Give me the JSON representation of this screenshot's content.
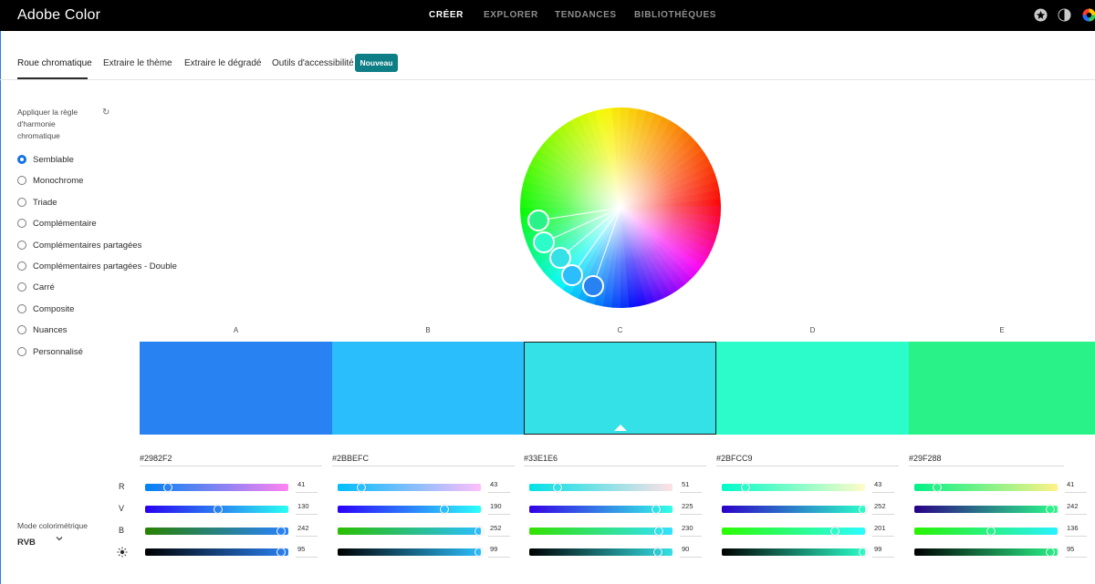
{
  "app": {
    "title": "Adobe Color"
  },
  "nav": {
    "items": [
      "CRÉER",
      "EXPLORER",
      "TENDANCES",
      "BIBLIOTHÈQUES"
    ],
    "active": "CRÉER"
  },
  "top_icons": [
    "star-circle-icon",
    "contrast-icon",
    "color-wheel-icon"
  ],
  "subtabs": {
    "items": [
      "Roue chromatique",
      "Extraire le thème",
      "Extraire le dégradé",
      "Outils d'accessibilité"
    ],
    "active": "Roue chromatique",
    "badge": "Nouveau"
  },
  "harmony": {
    "label": "Appliquer la règle d'harmonie chromatique",
    "selected": "Semblable",
    "options": [
      "Semblable",
      "Monochrome",
      "Triade",
      "Complémentaire",
      "Complémentaires partagées",
      "Complémentaires partagées - Double",
      "Carré",
      "Composite",
      "Nuances",
      "Personnalisé"
    ]
  },
  "color_mode": {
    "label": "Mode colorimétrique",
    "value": "RVB"
  },
  "channel_labels": [
    "R",
    "V",
    "B"
  ],
  "brightness_icon": "sun-icon",
  "colors": [
    {
      "letter": "A",
      "hex": "#2982F2",
      "r": 41,
      "v": 130,
      "b": 242,
      "brightness": 95,
      "selected": false
    },
    {
      "letter": "B",
      "hex": "#2BBEFC",
      "r": 43,
      "v": 190,
      "b": 252,
      "brightness": 99,
      "selected": false
    },
    {
      "letter": "C",
      "hex": "#33E1E6",
      "r": 51,
      "v": 225,
      "b": 230,
      "brightness": 90,
      "selected": true
    },
    {
      "letter": "D",
      "hex": "#2BFCC9",
      "r": 43,
      "v": 252,
      "b": 201,
      "brightness": 99,
      "selected": false
    },
    {
      "letter": "E",
      "hex": "#29F288",
      "r": 41,
      "v": 242,
      "b": 136,
      "brightness": 95,
      "selected": false
    }
  ],
  "accent": "#1473e6",
  "badge_color": "#0d7e85"
}
